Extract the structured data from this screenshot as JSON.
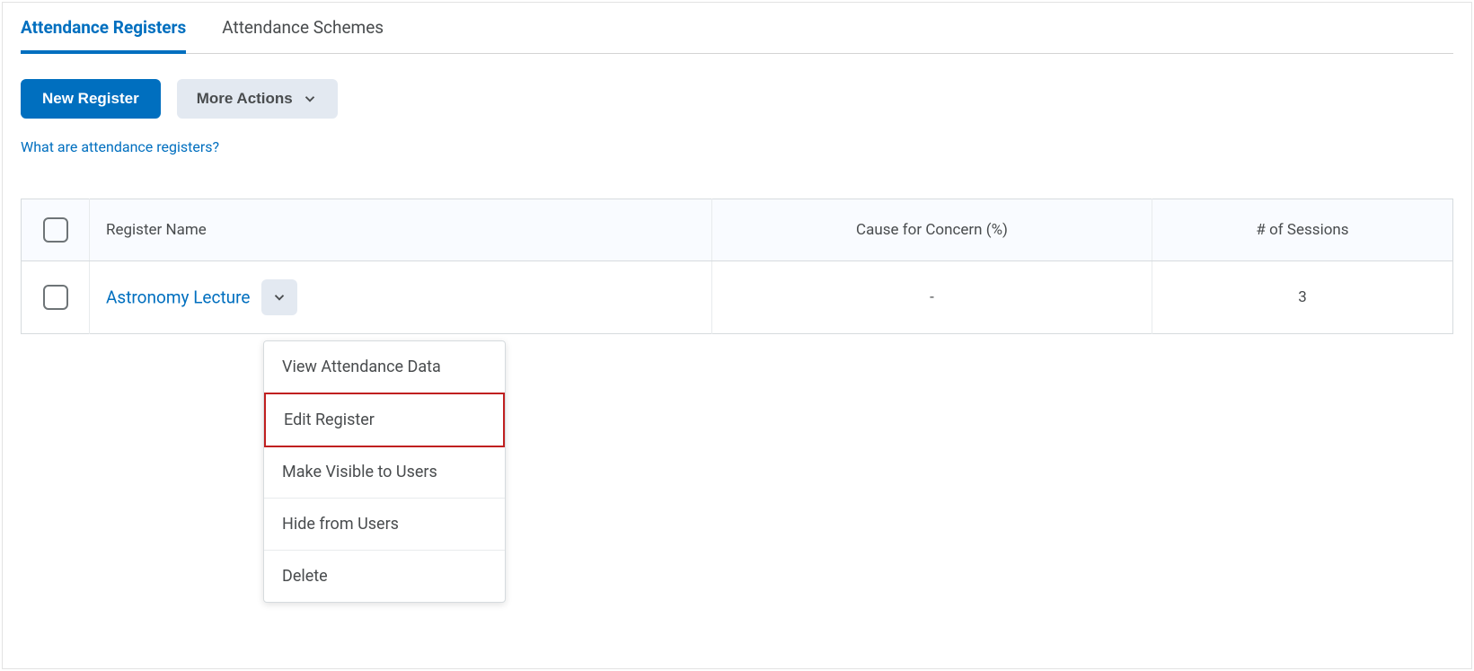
{
  "tabs": {
    "registers": "Attendance Registers",
    "schemes": "Attendance Schemes"
  },
  "actions": {
    "new_register": "New Register",
    "more_actions": "More Actions"
  },
  "help_link": "What are attendance registers?",
  "table": {
    "headers": {
      "name": "Register Name",
      "concern": "Cause for Concern (%)",
      "sessions": "# of Sessions"
    },
    "rows": [
      {
        "name": "Astronomy Lecture",
        "concern": "-",
        "sessions": "3"
      }
    ]
  },
  "dropdown": {
    "items": [
      "View Attendance Data",
      "Edit Register",
      "Make Visible to Users",
      "Hide from Users",
      "Delete"
    ],
    "highlighted_index": 1
  }
}
